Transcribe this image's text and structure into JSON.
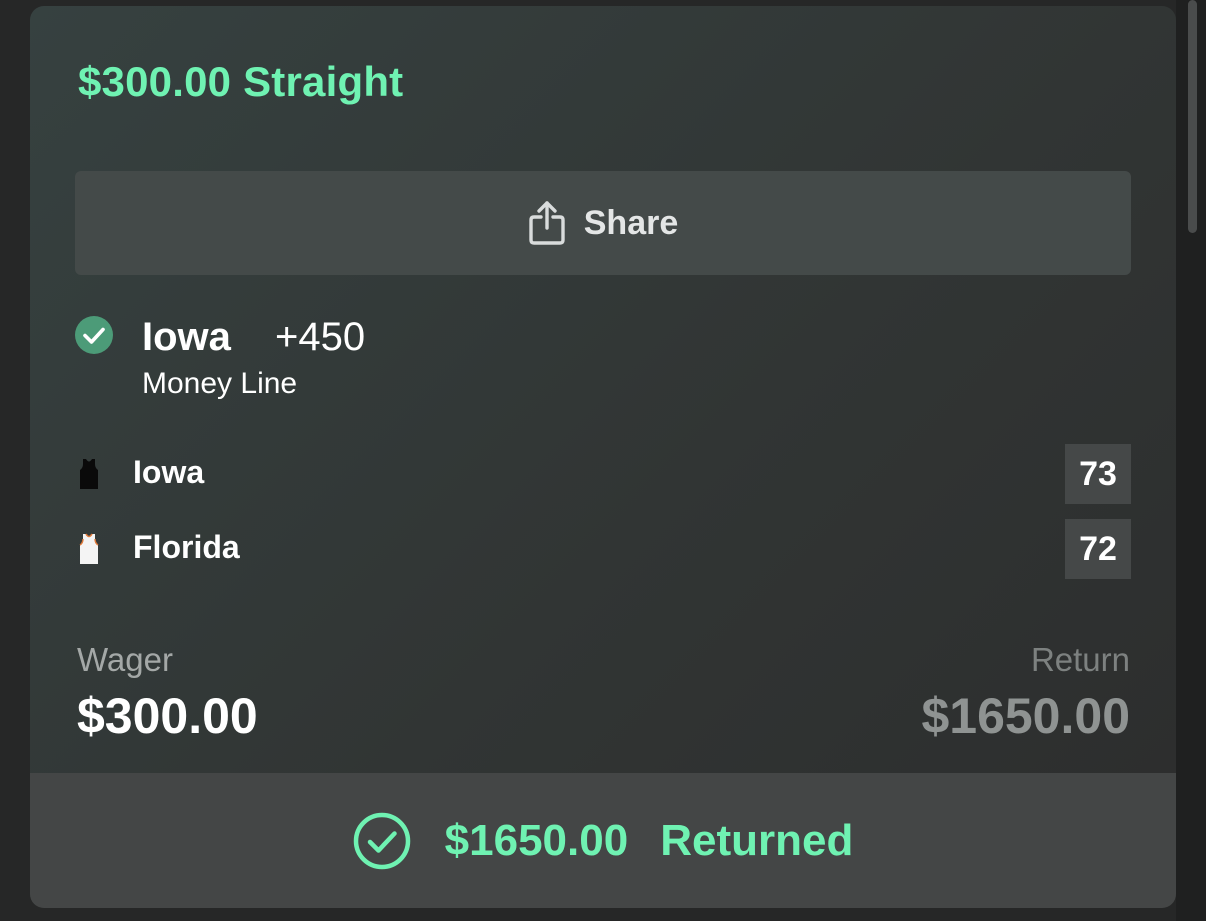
{
  "bet": {
    "title": "$300.00 Straight"
  },
  "share": {
    "label": "Share"
  },
  "selection": {
    "team": "Iowa",
    "odds": "+450",
    "market": "Money Line",
    "status": "won"
  },
  "teams": [
    {
      "name": "Iowa",
      "score": "73",
      "jersey_color": "#0a0a0a"
    },
    {
      "name": "Florida",
      "score": "72",
      "jersey_color": "#f4f4f4"
    }
  ],
  "wager": {
    "label": "Wager",
    "value": "$300.00"
  },
  "return": {
    "label": "Return",
    "value": "$1650.00"
  },
  "result": {
    "amount": "$1650.00",
    "status": "Returned"
  },
  "colors": {
    "accent": "#6ff2b2",
    "check_bg": "#4c9b78"
  }
}
